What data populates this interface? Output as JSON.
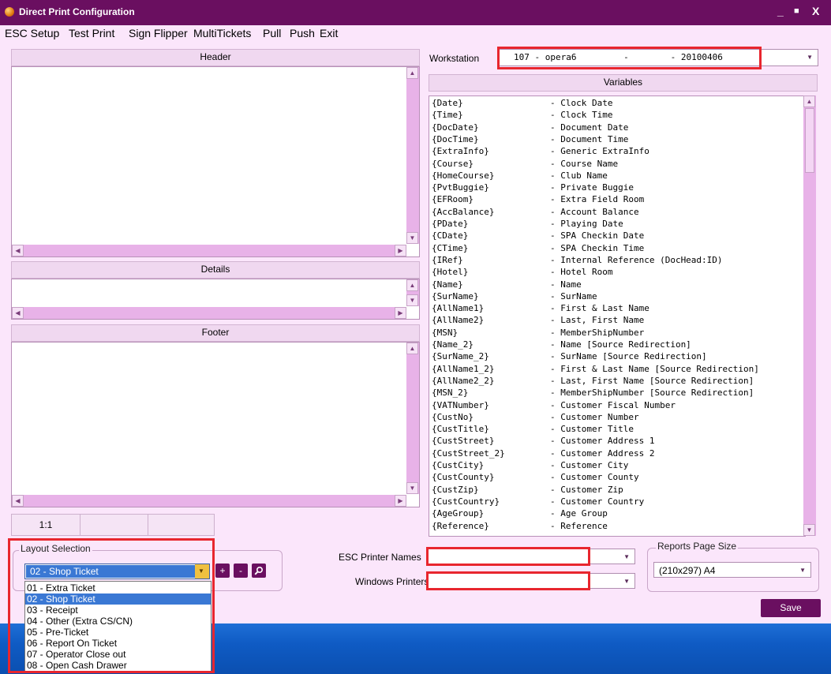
{
  "window": {
    "title": "Direct Print Configuration",
    "minimize": "_",
    "maximize": "■",
    "close": "X"
  },
  "menu": [
    "ESC Setup",
    "Test Print",
    "Sign Flipper",
    "MultiTickets",
    "Pull",
    "Push",
    "Exit"
  ],
  "panels": {
    "header": "Header",
    "details": "Details",
    "footer": "Footer",
    "variables": "Variables"
  },
  "workstation": {
    "label": "Workstation",
    "value": "107 - opera6         -        - 20100406"
  },
  "status": [
    "1:1",
    "",
    ""
  ],
  "layout_selection": {
    "title": "Layout Selection",
    "selected": "02 - Shop Ticket",
    "options": [
      "01 - Extra Ticket",
      "02 - Shop Ticket",
      "03 - Receipt",
      "04 - Other (Extra CS/CN)",
      "05 - Pre-Ticket",
      "06 - Report On Ticket",
      "07 - Operator Close out",
      "08 - Open Cash Drawer"
    ],
    "add": "+",
    "remove": "-"
  },
  "printers": {
    "esc_label": "ESC Printer Names",
    "esc_value": "",
    "windows_label": "Windows Printers",
    "windows_value": ""
  },
  "reports_page_size": {
    "title": "Reports Page Size",
    "value": "(210x297) A4"
  },
  "save_label": "Save",
  "variables": [
    [
      "{Date}",
      "- Clock Date"
    ],
    [
      "{Time}",
      "- Clock Time"
    ],
    [
      "{DocDate}",
      "- Document Date"
    ],
    [
      "{DocTime}",
      "- Document Time"
    ],
    [
      "{ExtraInfo}",
      "- Generic ExtraInfo"
    ],
    [
      "{Course}",
      "- Course Name"
    ],
    [
      "{HomeCourse}",
      "- Club Name"
    ],
    [
      "{PvtBuggie}",
      "- Private Buggie"
    ],
    [
      "{EFRoom}",
      "- Extra Field Room"
    ],
    [
      "{AccBalance}",
      "- Account Balance"
    ],
    [
      "{PDate}",
      "- Playing Date"
    ],
    [
      "{CDate}",
      "- SPA Checkin Date"
    ],
    [
      "{CTime}",
      "- SPA Checkin Time"
    ],
    [
      "{IRef}",
      "- Internal Reference (DocHead:ID)"
    ],
    [
      "{Hotel}",
      "- Hotel Room"
    ],
    [
      "{Name}",
      "- Name"
    ],
    [
      "{SurName}",
      "- SurName"
    ],
    [
      "{AllName1}",
      "- First & Last Name"
    ],
    [
      "{AllName2}",
      "- Last, First Name"
    ],
    [
      "{MSN}",
      "- MemberShipNumber"
    ],
    [
      "{Name_2}",
      "- Name [Source Redirection]"
    ],
    [
      "{SurName_2}",
      "- SurName [Source Redirection]"
    ],
    [
      "{AllName1_2}",
      "- First & Last Name [Source Redirection]"
    ],
    [
      "{AllName2_2}",
      "- Last, First Name [Source Redirection]"
    ],
    [
      "{MSN_2}",
      "- MemberShipNumber [Source Redirection]"
    ],
    [
      "{VATNumber}",
      "- Customer Fiscal Number"
    ],
    [
      "{CustNo}",
      "- Customer Number"
    ],
    [
      "{CustTitle}",
      "- Customer Title"
    ],
    [
      "{CustStreet}",
      "- Customer Address 1"
    ],
    [
      "{CustStreet_2}",
      "- Customer Address 2"
    ],
    [
      "{CustCity}",
      "- Customer City"
    ],
    [
      "{CustCounty}",
      "- Customer County"
    ],
    [
      "{CustZip}",
      "- Customer Zip"
    ],
    [
      "{CustCountry}",
      "- Customer Country"
    ],
    [
      "{AgeGroup}",
      "- Age Group"
    ],
    [
      "{Reference}",
      "- Reference"
    ]
  ],
  "colors": {
    "titlebar": "#6a0f60",
    "window_bg": "#fbe6fb",
    "scrollbar": "#e8b2e8",
    "highlight_box": "#e8262e",
    "selected_option": "#3a78d4"
  }
}
